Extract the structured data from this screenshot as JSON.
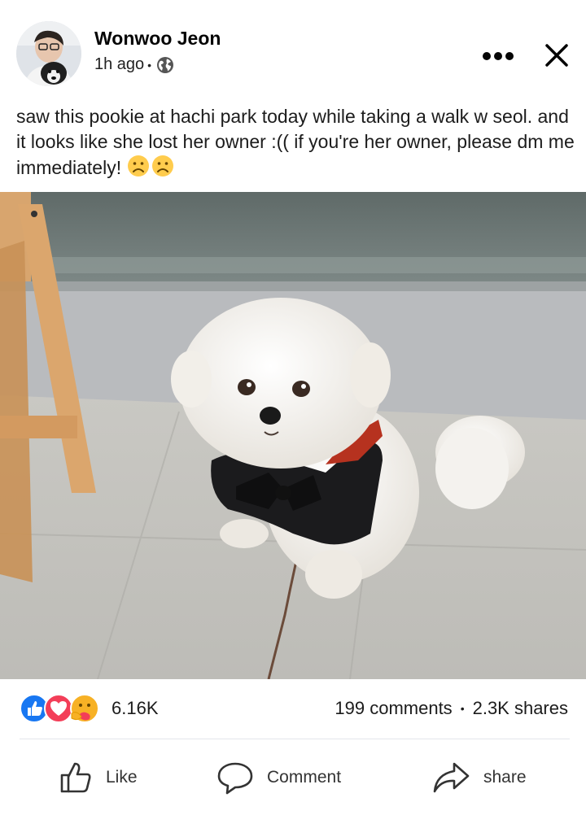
{
  "post": {
    "author": "Wonwoo Jeon",
    "time": "1h ago",
    "audience_icon": "globe-icon",
    "caption": "saw this pookie at hachi park today while taking a walk w seol. and it looks like she lost her owner :(( if you're her owner, please dm me immediately!",
    "caption_emoji": "frowning-face-emoji"
  },
  "header": {
    "more_icon": "more-dots-icon",
    "close_icon": "close-icon"
  },
  "stats": {
    "reactions_count": "6.16K",
    "comments": "199 comments",
    "separator": "•",
    "shares": "2.3K shares",
    "reaction_icons": [
      "like-reaction-icon",
      "love-reaction-icon",
      "care-reaction-icon"
    ]
  },
  "actions": {
    "like": "Like",
    "comment": "Comment",
    "share": "share"
  },
  "colors": {
    "like_blue": "#1877f2",
    "love_red": "#f33e58",
    "care_yellow": "#f7b125",
    "text": "#050505"
  }
}
